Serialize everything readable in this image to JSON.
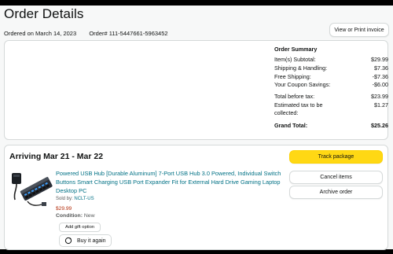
{
  "header": {
    "title": "Order Details",
    "ordered_on": "Ordered on March 14, 2023",
    "order_number": "Order# 111-5447661-5963452",
    "view_invoice_label": "View or Print invoice"
  },
  "summary": {
    "heading": "Order Summary",
    "rows": [
      {
        "label": "Item(s) Subtotal:",
        "value": "$29.99"
      },
      {
        "label": "Shipping & Handling:",
        "value": "$7.36"
      },
      {
        "label": "Free Shipping:",
        "value": "-$7.36"
      },
      {
        "label": "Your Coupon Savings:",
        "value": "-$6.00"
      },
      {
        "label": "Total before tax:",
        "value": "$23.99"
      },
      {
        "label": "Estimated tax to be collected:",
        "value": "$1.27"
      },
      {
        "label": "Grand Total:",
        "value": "$25.26"
      }
    ]
  },
  "shipment": {
    "arriving": "Arriving Mar 21 - Mar 22",
    "track_label": "Track package",
    "cancel_label": "Cancel items",
    "archive_label": "Archive order",
    "product": {
      "title": "Powered USB Hub [Durable Aluminum] 7-Port USB Hub 3.0 Powered, Individual Switch Buttons Smart Charging USB Port Expander Fit for External Hard Drive Gaming Laptop Desktop PC",
      "sold_by_label": "Sold by:",
      "seller": "NCLT-US",
      "price": "$29.99",
      "condition_label": "Condition:",
      "condition_value": "New",
      "gift_label": "Add gift option",
      "buy_again_label": "Buy it again"
    }
  },
  "colors": {
    "link": "#007185",
    "price": "#b12704",
    "primary_button": "#ffd814"
  }
}
